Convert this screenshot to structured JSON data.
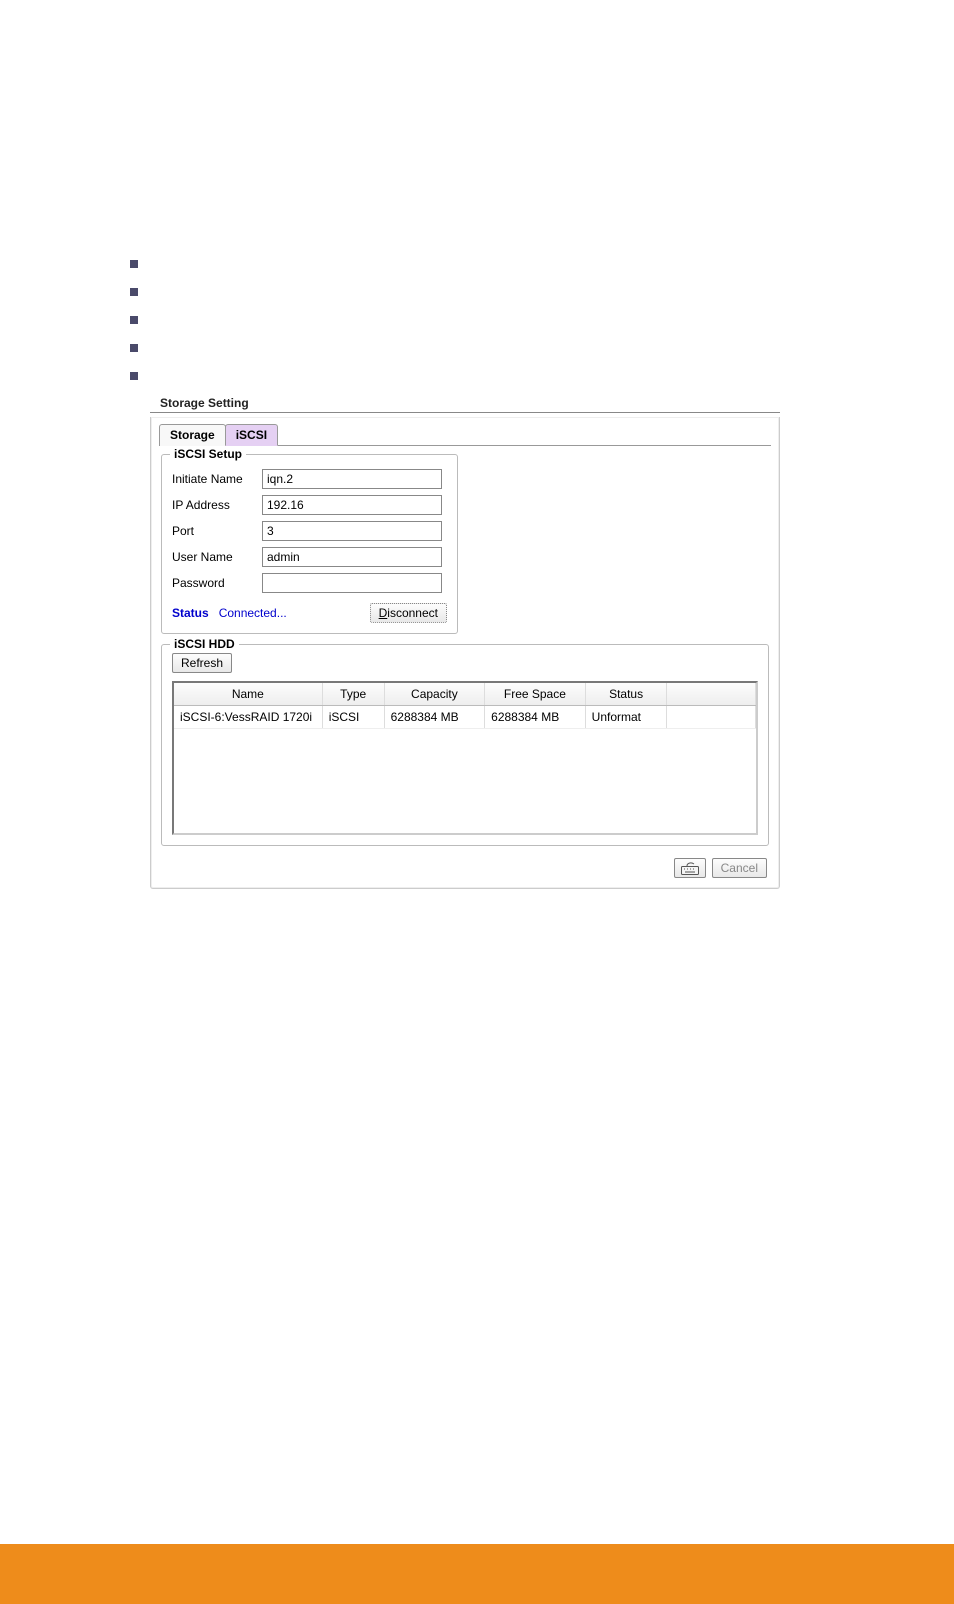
{
  "bullets": [
    "",
    "",
    "",
    "",
    ""
  ],
  "storage": {
    "title": "Storage Setting",
    "tabs": {
      "storage": "Storage",
      "iscsi": "iSCSI"
    },
    "setup": {
      "legend": "iSCSI Setup",
      "initiate_label": "Initiate Name",
      "initiate_value": "iqn.2",
      "ip_label": "IP Address",
      "ip_value": "192.16",
      "port_label": "Port",
      "port_value": "3",
      "user_label": "User Name",
      "user_value": "admin",
      "pass_label": "Password",
      "pass_value": "",
      "status_label": "Status",
      "status_value": "Connected...",
      "disconnect_label": "Disconnect"
    },
    "hdd": {
      "legend": "iSCSI HDD",
      "refresh_label": "Refresh",
      "headers": {
        "name": "Name",
        "type": "Type",
        "capacity": "Capacity",
        "free": "Free Space",
        "status": "Status"
      },
      "rows": [
        {
          "name": "iSCSI-6:VessRAID 1720i",
          "type": "iSCSI",
          "capacity": "6288384 MB",
          "free": "6288384 MB",
          "status": "Unformat"
        }
      ]
    },
    "cancel_label": "Cancel"
  }
}
